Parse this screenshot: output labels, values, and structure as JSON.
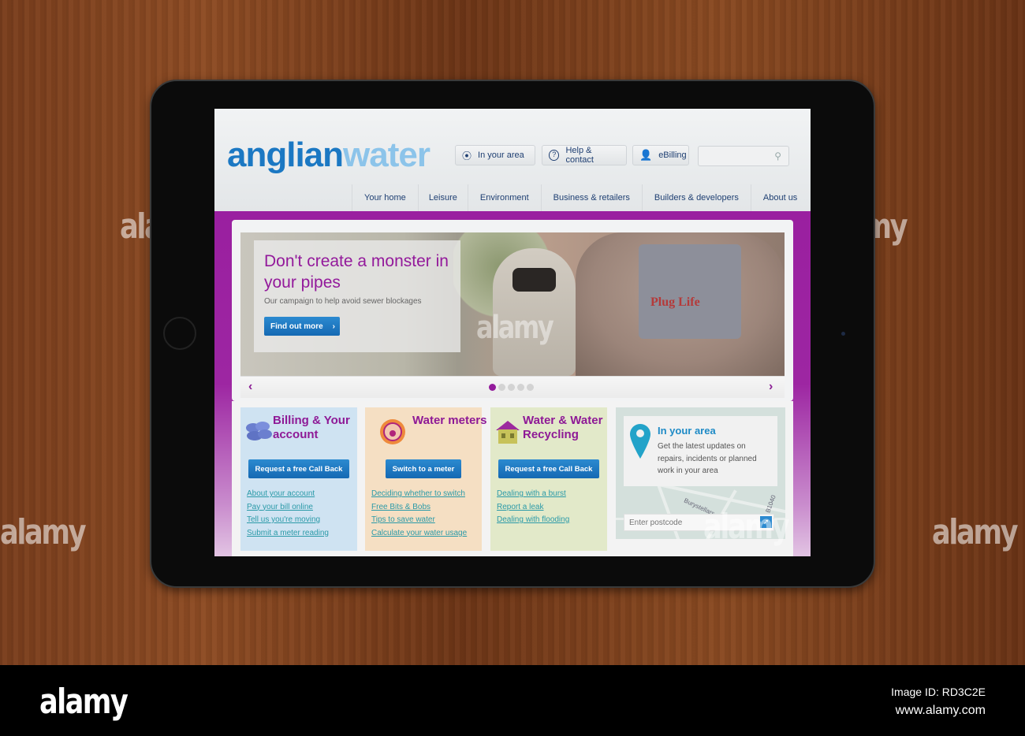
{
  "site": {
    "logo_part1": "anglian",
    "logo_part2": "water"
  },
  "header": {
    "utility": [
      {
        "icon": "location-signal-icon",
        "label": "In your area"
      },
      {
        "icon": "help-bubble-icon",
        "label": "Help & contact"
      },
      {
        "icon": "user-icon",
        "label": "eBilling"
      }
    ],
    "search": {
      "placeholder": "",
      "icon": "search-icon"
    },
    "nav": [
      "Your home",
      "Leisure",
      "Environment",
      "Business & retailers",
      "Builders & developers",
      "About us"
    ]
  },
  "hero": {
    "title": "Don't create a monster in your pipes",
    "subtitle": "Our campaign to help avoid sewer blockages",
    "cta": "Find out more",
    "image_caption": "Plug Life",
    "slides_total": 5,
    "active_slide": 1,
    "prev_icon": "‹",
    "next_icon": "›",
    "colors": {
      "title": "#93199b",
      "button": "#1b78c3"
    }
  },
  "cards": [
    {
      "title": "Billing & Your account",
      "icon": "coins-icon",
      "button": "Request a free Call Back",
      "links": [
        "About your account",
        "Pay your bill online",
        "Tell us you're moving",
        "Submit a meter reading"
      ],
      "bg": "#cfe3f2"
    },
    {
      "title": "Water meters",
      "icon": "water-meter-icon",
      "button": "Switch to a meter",
      "links": [
        "Deciding whether to switch",
        "Free Bits & Bobs",
        "Tips to save water",
        "Calculate your water usage"
      ],
      "bg": "#f5dfc3"
    },
    {
      "title": "Water & Water Recycling",
      "icon": "house-icon",
      "button": "Request a free Call Back",
      "links": [
        "Dealing with a burst",
        "Report a leak",
        "Dealing with flooding"
      ],
      "bg": "#e2e9c9"
    }
  ],
  "area": {
    "title": "In your area",
    "text": "Get the latest updates on repairs, incidents or planned work in your area",
    "postcode_placeholder": "Enter postcode",
    "go_icon": "arrow-icon",
    "map_labels": [
      "Burystellars",
      "B1040"
    ]
  },
  "watermark": {
    "brand": "alamy",
    "image_id": "Image ID: RD3C2E",
    "url": "www.alamy.com"
  }
}
